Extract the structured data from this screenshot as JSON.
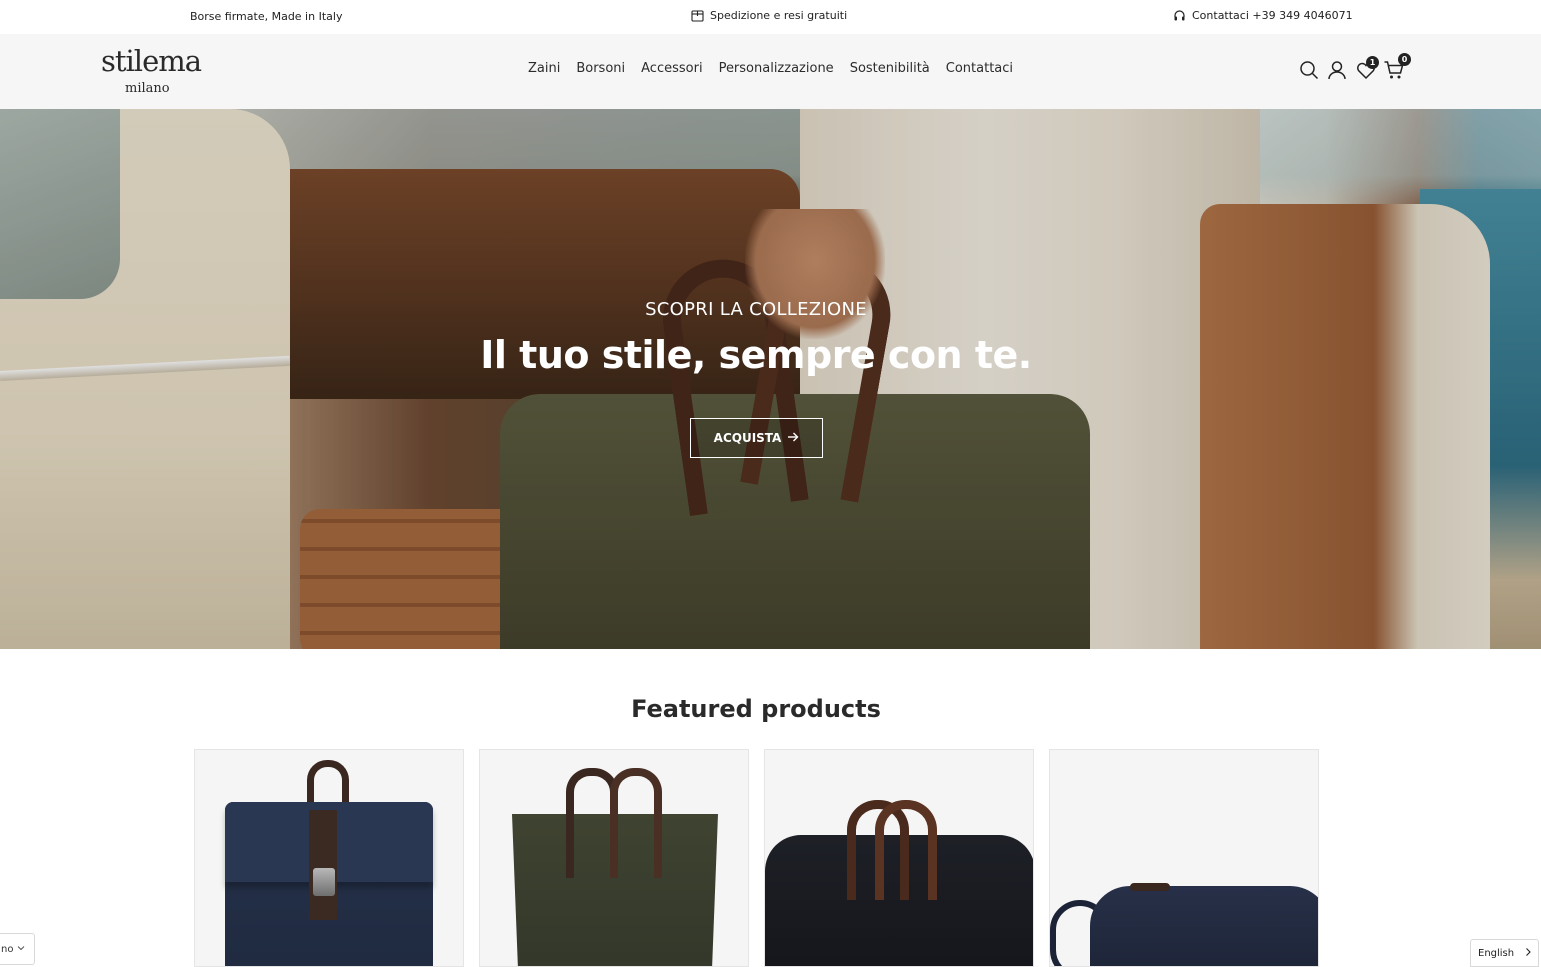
{
  "announcement": {
    "left_text": "Borse firmate, Made in Italy",
    "center_text": "Spedizione e resi gratuiti",
    "center_icon": "package-icon",
    "right_text": "Contattaci +39 349 4046071",
    "right_icon": "headphones-icon"
  },
  "header": {
    "logo_main": "stilema",
    "logo_sub": "milano",
    "nav": [
      "Zaini",
      "Borsoni",
      "Accessori",
      "Personalizzazione",
      "Sostenibilità",
      "Contattaci"
    ],
    "icons": [
      "search-icon",
      "account-icon",
      "wishlist-icon",
      "cart-icon"
    ],
    "wishlist_count": "1",
    "cart_count": "0"
  },
  "hero": {
    "subtitle": "SCOPRI LA COLLEZIONE",
    "title": "Il tuo stile, sempre con te.",
    "button_label": "ACQUISTA",
    "button_icon": "arrow-right-icon"
  },
  "featured": {
    "title": "Featured products"
  },
  "widgets": {
    "left_lang_text": "no",
    "right_lang_text": "English"
  },
  "colors": {
    "accent": "#222222",
    "header_bg": "#f6f6f6",
    "card_bg": "#f5f5f5"
  }
}
